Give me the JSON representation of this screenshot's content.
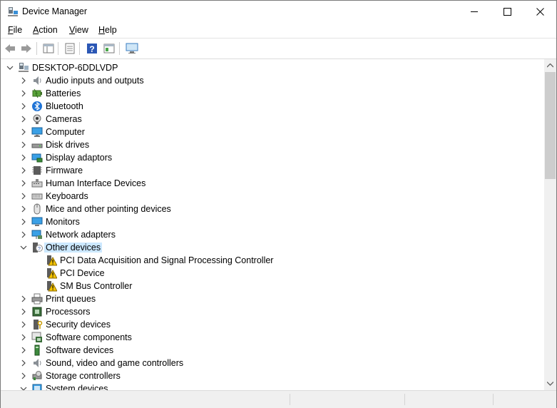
{
  "window": {
    "title": "Device Manager"
  },
  "menu": {
    "file": "F",
    "file_rest": "ile",
    "action": "A",
    "action_rest": "ction",
    "view": "V",
    "view_rest": "iew",
    "help": "H",
    "help_rest": "elp"
  },
  "toolbar": {
    "items": [
      "back-icon",
      "forward-icon",
      "properties-icon",
      "show-hide-icon",
      "help-icon",
      "action-pane-icon",
      "computer-scan-icon"
    ]
  },
  "tree": {
    "root": "DESKTOP-6DDLVDP",
    "items": [
      {
        "label": "Audio inputs and outputs",
        "icon": "speaker-icon"
      },
      {
        "label": "Batteries",
        "icon": "battery-icon"
      },
      {
        "label": "Bluetooth",
        "icon": "bluetooth-icon"
      },
      {
        "label": "Cameras",
        "icon": "camera-icon"
      },
      {
        "label": "Computer",
        "icon": "computer-icon"
      },
      {
        "label": "Disk drives",
        "icon": "disk-drive-icon"
      },
      {
        "label": "Display adaptors",
        "icon": "display-adapter-icon"
      },
      {
        "label": "Firmware",
        "icon": "firmware-icon"
      },
      {
        "label": "Human Interface Devices",
        "icon": "hid-icon"
      },
      {
        "label": "Keyboards",
        "icon": "keyboard-icon"
      },
      {
        "label": "Mice and other pointing devices",
        "icon": "mouse-icon"
      },
      {
        "label": "Monitors",
        "icon": "monitor-icon"
      },
      {
        "label": "Network adapters",
        "icon": "network-adapter-icon"
      },
      {
        "label": "Other devices",
        "icon": "unknown-device-icon",
        "expanded": true,
        "selected": true,
        "children": [
          {
            "label": "PCI Data Acquisition and Signal Processing Controller",
            "icon": "warning-device-icon"
          },
          {
            "label": "PCI Device",
            "icon": "warning-device-icon"
          },
          {
            "label": "SM Bus Controller",
            "icon": "warning-device-icon"
          }
        ]
      },
      {
        "label": "Print queues",
        "icon": "printer-icon"
      },
      {
        "label": "Processors",
        "icon": "processor-icon"
      },
      {
        "label": "Security devices",
        "icon": "security-device-icon"
      },
      {
        "label": "Software components",
        "icon": "software-component-icon"
      },
      {
        "label": "Software devices",
        "icon": "software-device-icon"
      },
      {
        "label": "Sound, video and game controllers",
        "icon": "sound-icon"
      },
      {
        "label": "Storage controllers",
        "icon": "storage-controller-icon"
      },
      {
        "label": "System devices",
        "icon": "system-device-icon",
        "expanded": true
      }
    ]
  },
  "colors": {
    "selection": "#cce8ff",
    "accent": "#1e90d6"
  }
}
